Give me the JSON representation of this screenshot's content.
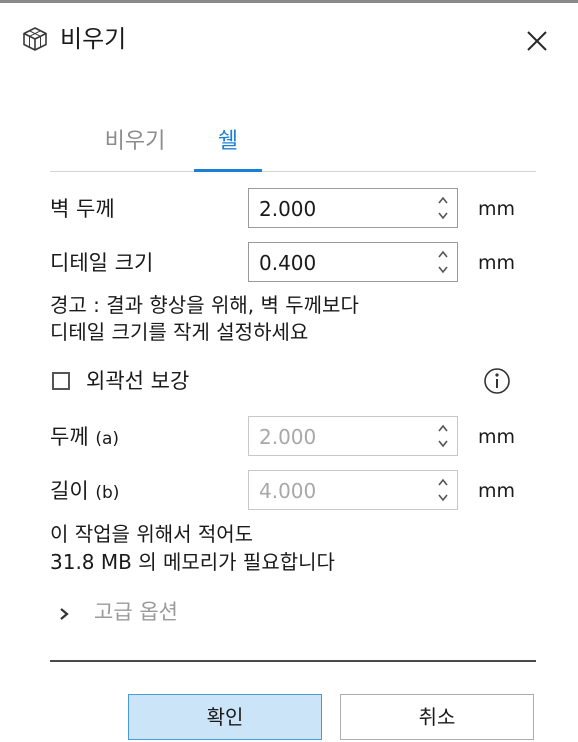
{
  "dialog": {
    "title": "비우기",
    "title_icon": "cube-wireframe-icon",
    "close_icon": "close-icon"
  },
  "tabs": [
    {
      "label": "비우기",
      "active": false
    },
    {
      "label": "쉘",
      "active": true
    }
  ],
  "fields": {
    "wall_thickness": {
      "label": "벽 두께",
      "value": "2.000",
      "unit": "mm",
      "enabled": true
    },
    "detail_size": {
      "label": "디테일 크기",
      "value": "0.400",
      "unit": "mm",
      "enabled": true
    },
    "thickness_a": {
      "label": "두께",
      "label_suffix": "(a)",
      "value": "2.000",
      "unit": "mm",
      "enabled": false
    },
    "length_b": {
      "label": "길이",
      "label_suffix": "(b)",
      "value": "4.000",
      "unit": "mm",
      "enabled": false
    }
  },
  "warning": {
    "line1": "경고 : 결과 향상을 위해, 벽 두께보다",
    "line2": "디테일 크기를 작게 설정하세요"
  },
  "outline_reinforce": {
    "label": "외곽선 보강",
    "checked": false,
    "info_icon": "info-icon"
  },
  "memory_note": {
    "line1": "이 작업을 위해서 적어도",
    "line2": "31.8 MB 의 메모리가 필요합니다"
  },
  "advanced": {
    "label": "고급 옵션",
    "icon": "chevron-right-icon"
  },
  "buttons": {
    "ok": "확인",
    "cancel": "취소"
  },
  "colors": {
    "accent": "#1b7fd3",
    "ok_bg": "#cce4f7",
    "ok_border": "#4a9bd9"
  }
}
